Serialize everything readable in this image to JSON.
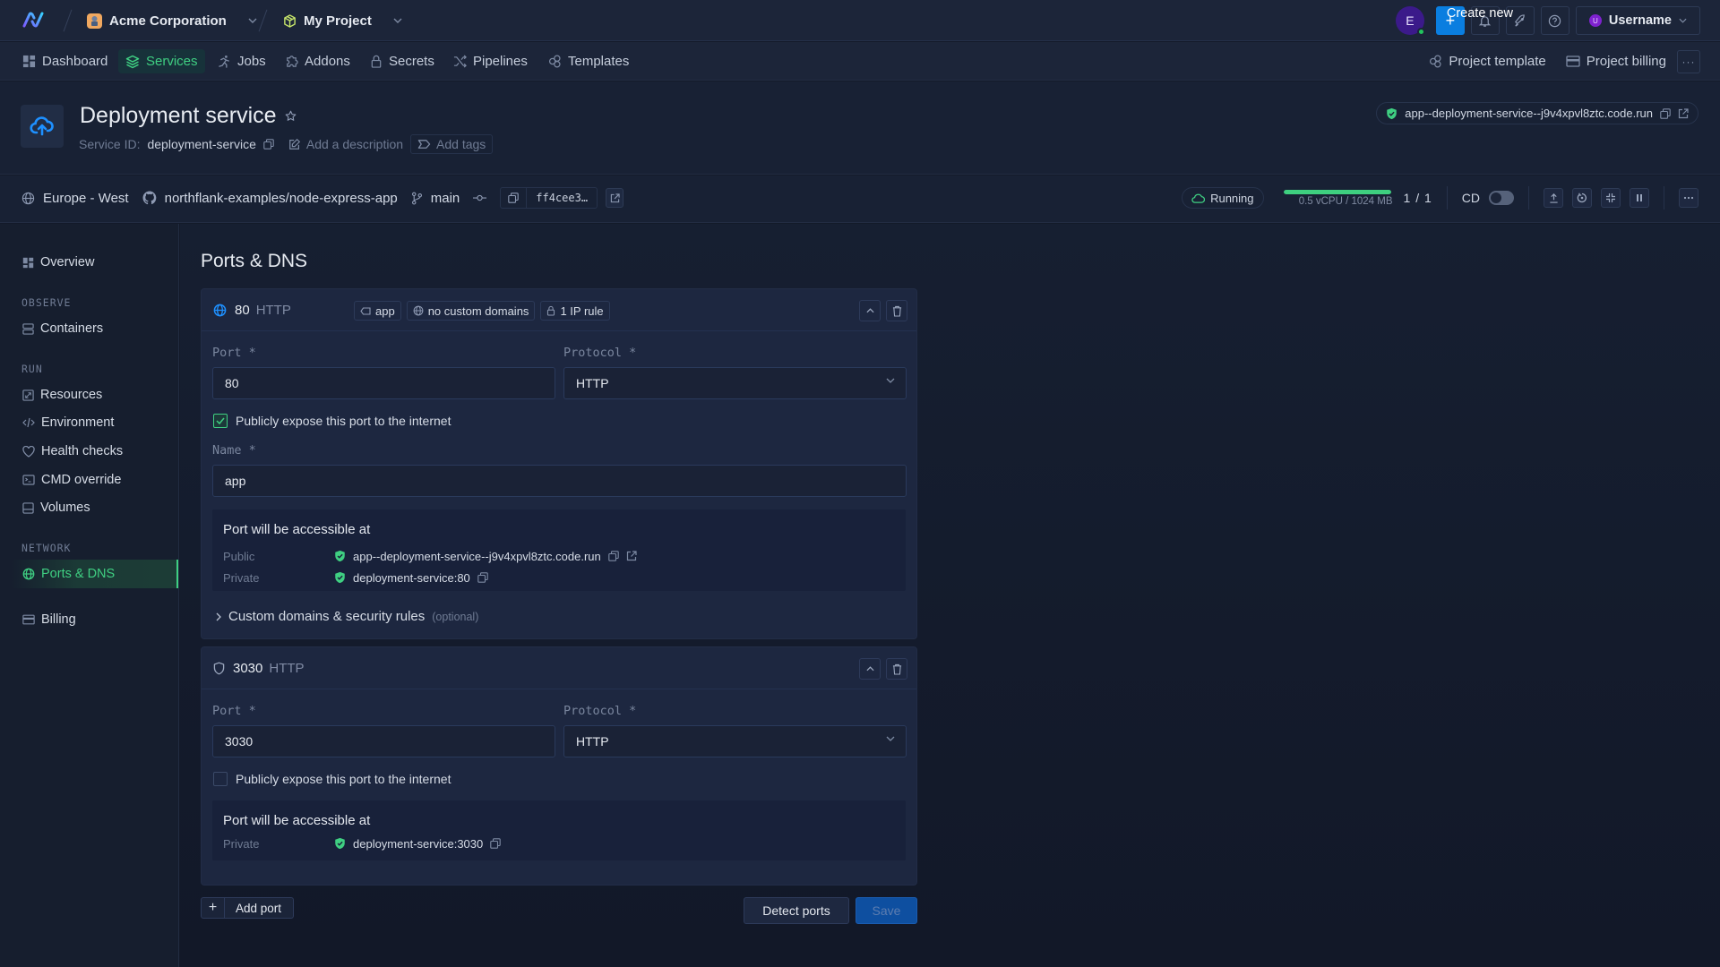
{
  "topbar": {
    "org_name": "Acme Corporation",
    "project_name": "My Project",
    "user_initial": "E",
    "create_label": "Create new",
    "username": "Username",
    "username_initial": "U"
  },
  "nav": {
    "items": [
      {
        "label": "Dashboard",
        "icon": "dashboard-icon"
      },
      {
        "label": "Services",
        "icon": "layers-icon",
        "active": true
      },
      {
        "label": "Jobs",
        "icon": "running-icon"
      },
      {
        "label": "Addons",
        "icon": "puzzle-icon"
      },
      {
        "label": "Secrets",
        "icon": "lock-icon"
      },
      {
        "label": "Pipelines",
        "icon": "shuffle-icon"
      },
      {
        "label": "Templates",
        "icon": "template-icon"
      }
    ],
    "right": {
      "project_template": "Project template",
      "project_billing": "Project billing",
      "more": "···"
    }
  },
  "service": {
    "title": "Deployment service",
    "id_label": "Service ID:",
    "id_value": "deployment-service",
    "add_description": "Add a description",
    "add_tags": "Add tags",
    "public_url": "app--deployment-service--j9v4xpvl8ztc.code.run"
  },
  "infobar": {
    "region": "Europe - West",
    "repo": "northflank-examples/node-express-app",
    "branch": "main",
    "commit": "ff4cee3…",
    "status": "Running",
    "usage_fraction": 1.0,
    "resources": "0.5 vCPU / 1024 MB",
    "instances": "1 / 1",
    "cd_label": "CD",
    "cd_enabled": false
  },
  "sidebar": {
    "overview": "Overview",
    "sections": {
      "observe": "OBSERVE",
      "run": "RUN",
      "network": "NETWORK"
    },
    "items": {
      "containers": "Containers",
      "resources": "Resources",
      "environment": "Environment",
      "health": "Health checks",
      "cmd": "CMD override",
      "volumes": "Volumes",
      "ports": "Ports & DNS",
      "billing": "Billing"
    }
  },
  "main": {
    "title": "Ports & DNS",
    "labels": {
      "port": "Port *",
      "protocol": "Protocol *",
      "name": "Name *",
      "expose": "Publicly expose this port to the internet",
      "accessible": "Port will be accessible at",
      "public": "Public",
      "private": "Private",
      "custom": "Custom domains & security rules",
      "optional": "(optional)"
    },
    "ports": [
      {
        "number": "80",
        "protocol": "HTTP",
        "chips": [
          "app",
          "no custom domains",
          "1 IP rule"
        ],
        "port_value": "80",
        "protocol_value": "HTTP",
        "public_exposed": true,
        "name_value": "app",
        "public_url": "app--deployment-service--j9v4xpvl8ztc.code.run",
        "private_url": "deployment-service:80"
      },
      {
        "number": "3030",
        "protocol": "HTTP",
        "port_value": "3030",
        "protocol_value": "HTTP",
        "public_exposed": false,
        "private_url": "deployment-service:3030"
      }
    ],
    "add_port": "Add port",
    "detect_ports": "Detect ports",
    "save": "Save"
  },
  "colors": {
    "accent_green": "#3fcf82",
    "primary_blue": "#0f8ff5",
    "background": "#131a29"
  }
}
